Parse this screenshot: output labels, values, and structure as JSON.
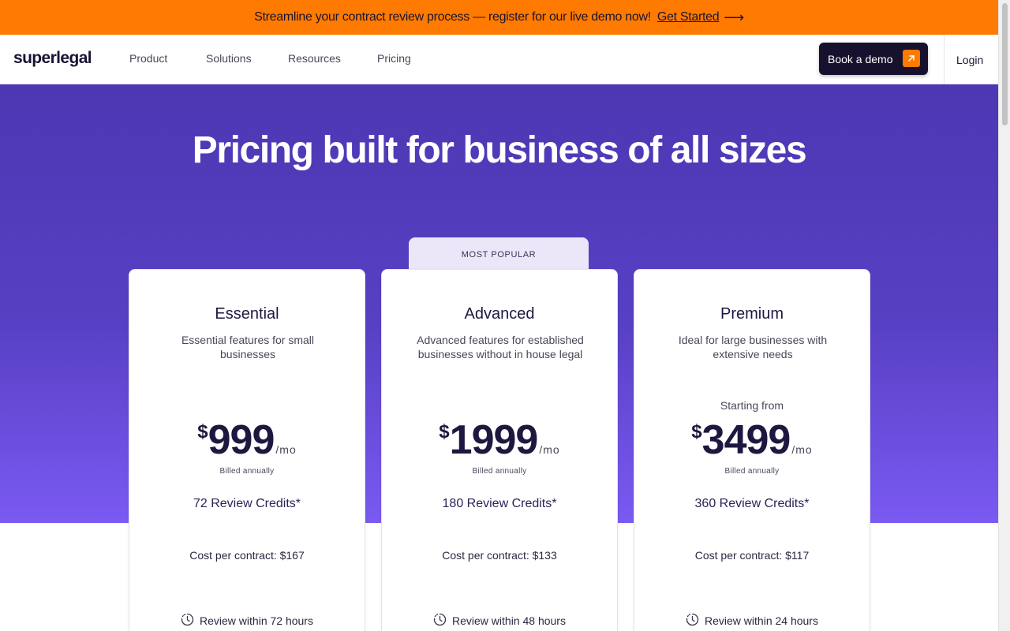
{
  "announcement": {
    "text": "Streamline your contract review process — register for our live demo now!",
    "link": "Get Started",
    "arrow": "⟶"
  },
  "nav": {
    "logo": "superlegal",
    "items": [
      "Product",
      "Solutions",
      "Resources",
      "Pricing"
    ],
    "demo_button": "Book a demo",
    "login": "Login"
  },
  "hero": {
    "title": "Pricing built for business of all sizes"
  },
  "badge": "MOST POPULAR",
  "plans": [
    {
      "name": "Essential",
      "description": "Essential features for small businesses",
      "starting_from": "",
      "currency": "$",
      "price": "999",
      "period": "/mo",
      "billed": "Billed annually",
      "credits": "72 Review Credits*",
      "cost": "Cost per contract: $167",
      "review": "Review within 72 hours"
    },
    {
      "name": "Advanced",
      "description": "Advanced features for established businesses without in house legal",
      "starting_from": "",
      "currency": "$",
      "price": "1999",
      "period": "/mo",
      "billed": "Billed annually",
      "credits": "180 Review Credits*",
      "cost": "Cost per contract: $133",
      "review": "Review within 48 hours"
    },
    {
      "name": "Premium",
      "description": "Ideal for large businesses with extensive needs",
      "starting_from": "Starting from",
      "currency": "$",
      "price": "3499",
      "period": "/mo",
      "billed": "Billed annually",
      "credits": "360 Review Credits*",
      "cost": "Cost per contract: $117",
      "review": "Review within 24 hours"
    }
  ],
  "icons": {
    "demo_arrow": "arrow-up-right-icon",
    "review": "clock-icon"
  },
  "colors": {
    "accent": "#ff7a00",
    "hero_top": "#4d37b2",
    "hero_bottom": "#7a5af2",
    "dark": "#17112e"
  }
}
